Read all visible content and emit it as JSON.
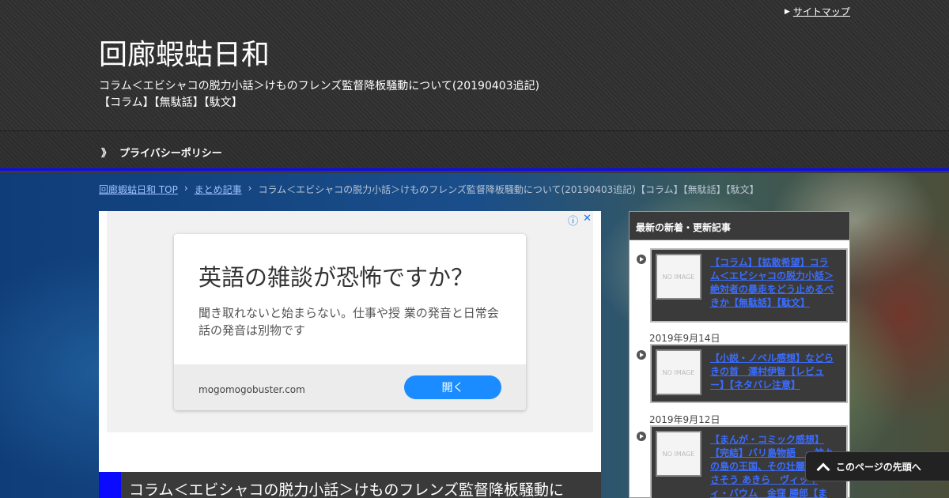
{
  "header": {
    "site_title": "回廊蝦蛄日和",
    "description_line1": "コラム＜エビシャコの脱力小話＞けものフレンズ監督降板騒動について(20190403追記)",
    "description_line2": "【コラム】【無駄話】【駄文】",
    "sitemap_label": "サイトマップ"
  },
  "nav": {
    "items": [
      {
        "label": "プライバシーポリシー"
      }
    ]
  },
  "breadcrumb": {
    "home": "回廊蝦蛄日和 TOP",
    "category": "まとめ記事",
    "separator": "›",
    "current": "コラム＜エビシャコの脱力小話＞けものフレンズ監督降板騒動について(20190403追記)【コラム】【無駄話】【駄文】"
  },
  "ad": {
    "headline": "英語の雑談が恐怖ですか？",
    "body": "聞き取れないと始まらない。仕事や授 業の発音と日常会話の発音は別物です",
    "domain": "mogomogobuster.com",
    "button_label": "開く",
    "info_icon": "info-icon",
    "close_icon": "close-icon"
  },
  "article": {
    "title": "コラム＜エビシャコの脱力小話＞けものフレンズ監督降板騒動に"
  },
  "sidebar": {
    "heading": "最新の新着・更新記事",
    "thumb_text": "NO IMAGE",
    "posts": [
      {
        "title": "【コラム】【拡散希望】コラム＜エビシャコの脱力小話＞絶対者の暴走をどう止めるべきか【無駄話】【駄文】",
        "date": ""
      },
      {
        "title": "【小説・ノベル感想】などらきの首　澤村伊智【レビュー】【ネタバレ注意】",
        "date": "2019年9月14日"
      },
      {
        "title": "【まんが・コミック感想】【完結】バリ島物語　－神々の島の王国、その壮麗なる死　さそう あきら　ヴィッキィ・バウム　金窪 勝郎【まとめ】【レビュー】",
        "date": "2019年9月12日"
      }
    ]
  },
  "back_to_top": {
    "label": "このページの先頭へ"
  },
  "colors": {
    "accent": "#0a0aff",
    "link": "#3a6cff",
    "ad_button": "#1a8cff"
  }
}
